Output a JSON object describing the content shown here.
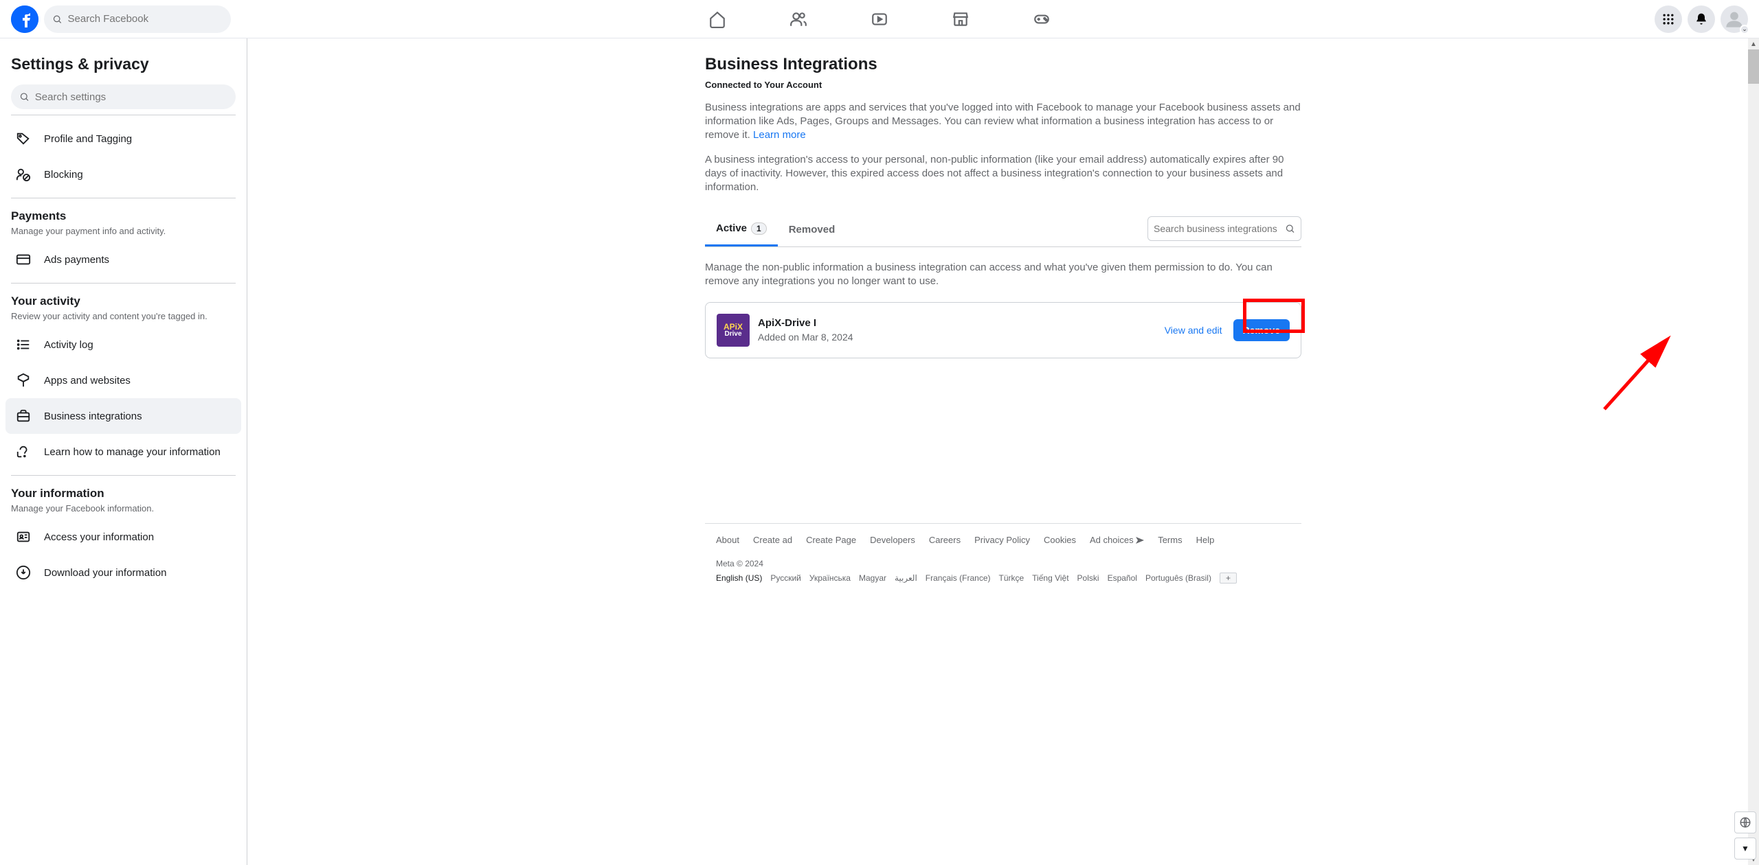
{
  "header": {
    "search_placeholder": "Search Facebook"
  },
  "sidebar": {
    "title": "Settings & privacy",
    "search_placeholder": "Search settings",
    "items_top": [
      {
        "label": "Profile and Tagging"
      },
      {
        "label": "Blocking"
      }
    ],
    "section_payments": {
      "title": "Payments",
      "desc": "Manage your payment info and activity.",
      "items": [
        {
          "label": "Ads payments"
        }
      ]
    },
    "section_activity": {
      "title": "Your activity",
      "desc": "Review your activity and content you're tagged in.",
      "items": [
        {
          "label": "Activity log"
        },
        {
          "label": "Apps and websites"
        },
        {
          "label": "Business integrations"
        },
        {
          "label": "Learn how to manage your information"
        }
      ]
    },
    "section_info": {
      "title": "Your information",
      "desc": "Manage your Facebook information.",
      "items": [
        {
          "label": "Access your information"
        },
        {
          "label": "Download your information"
        }
      ]
    }
  },
  "main": {
    "title": "Business Integrations",
    "subtitle": "Connected to Your Account",
    "description1a": "Business integrations are apps and services that you've logged into with Facebook to manage your Facebook business assets and information like Ads, Pages, Groups and Messages. You can review what information a business integration has access to or remove it. ",
    "learn_more": "Learn more",
    "description2": "A business integration's access to your personal, non-public information (like your email address) automatically expires after 90 days of inactivity. However, this expired access does not affect a business integration's connection to your business assets and information.",
    "tabs": {
      "active": "Active",
      "active_count": "1",
      "removed": "Removed"
    },
    "search_placeholder": "Search business integrations",
    "manage_description": "Manage the non-public information a business integration can access and what you've given them permission to do. You can remove any integrations you no longer want to use.",
    "integration": {
      "name": "ApiX-Drive I",
      "date": "Added on Mar 8, 2024",
      "view_edit": "View and edit",
      "remove": "Remove",
      "logo_l1": "APiX",
      "logo_l2": "Drive"
    }
  },
  "footer": {
    "links": [
      "About",
      "Create ad",
      "Create Page",
      "Developers",
      "Careers",
      "Privacy Policy",
      "Cookies",
      "Ad choices",
      "Terms",
      "Help"
    ],
    "meta_text": "Meta © 2024",
    "langs": [
      "English (US)",
      "Русский",
      "Українська",
      "Magyar",
      "العربية",
      "Français (France)",
      "Türkçe",
      "Tiếng Việt",
      "Polski",
      "Español",
      "Português (Brasil)"
    ],
    "lang_plus": "+"
  }
}
